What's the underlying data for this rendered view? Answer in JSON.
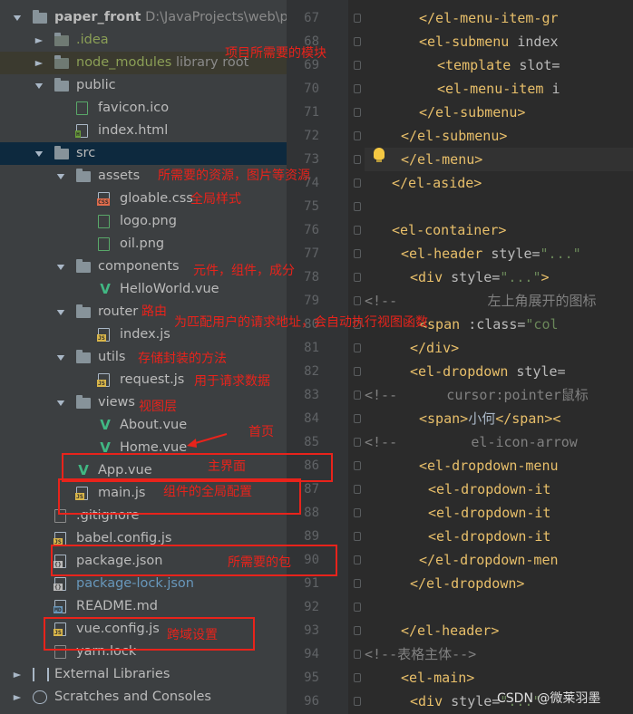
{
  "project": {
    "name": "paper_front",
    "path": "D:\\JavaProjects\\web\\pap"
  },
  "tree": [
    {
      "label": "paper_front",
      "suffix": "D:\\JavaProjects\\web\\pap",
      "indent": 0,
      "arrow": "down",
      "icon": "folder-icon",
      "color": "#bbbbbb",
      "bold": true
    },
    {
      "label": ".idea",
      "indent": 1,
      "arrow": "right",
      "icon": "folder-icon",
      "color": "#8b9f56"
    },
    {
      "label": "node_modules",
      "suffix": "library root",
      "indent": 1,
      "arrow": "right",
      "icon": "folder-icon",
      "color": "#8b9f56",
      "highlight": true
    },
    {
      "label": "public",
      "indent": 1,
      "arrow": "down",
      "icon": "folder-icon",
      "color": "#bbbbbb"
    },
    {
      "label": "favicon.ico",
      "indent": 2,
      "icon": "image-file-icon",
      "color": "#bbbbbb"
    },
    {
      "label": "index.html",
      "indent": 2,
      "icon": "html-file-icon",
      "color": "#bbbbbb"
    },
    {
      "label": "src",
      "indent": 1,
      "arrow": "down",
      "icon": "folder-icon",
      "color": "#bbbbbb",
      "selected": true
    },
    {
      "label": "assets",
      "indent": 2,
      "arrow": "down",
      "icon": "folder-icon",
      "color": "#bbbbbb"
    },
    {
      "label": "gloable.css",
      "indent": 3,
      "icon": "css-file-icon",
      "color": "#bbbbbb"
    },
    {
      "label": "logo.png",
      "indent": 3,
      "icon": "image-file-icon",
      "color": "#bbbbbb"
    },
    {
      "label": "oil.png",
      "indent": 3,
      "icon": "image-file-icon",
      "color": "#bbbbbb"
    },
    {
      "label": "components",
      "indent": 2,
      "arrow": "down",
      "icon": "folder-icon",
      "color": "#bbbbbb"
    },
    {
      "label": "HelloWorld.vue",
      "indent": 3,
      "icon": "vue-file-icon",
      "color": "#bbbbbb"
    },
    {
      "label": "router",
      "indent": 2,
      "arrow": "down",
      "icon": "folder-icon",
      "color": "#bbbbbb"
    },
    {
      "label": "index.js",
      "indent": 3,
      "icon": "js-file-icon",
      "color": "#bbbbbb"
    },
    {
      "label": "utils",
      "indent": 2,
      "arrow": "down",
      "icon": "folder-icon",
      "color": "#bbbbbb"
    },
    {
      "label": "request.js",
      "indent": 3,
      "icon": "js-file-icon",
      "color": "#bbbbbb"
    },
    {
      "label": "views",
      "indent": 2,
      "arrow": "down",
      "icon": "folder-icon",
      "color": "#bbbbbb"
    },
    {
      "label": "About.vue",
      "indent": 3,
      "icon": "vue-file-icon",
      "color": "#bbbbbb"
    },
    {
      "label": "Home.vue",
      "indent": 3,
      "icon": "vue-file-icon",
      "color": "#bbbbbb"
    },
    {
      "label": "App.vue",
      "indent": 2,
      "icon": "vue-file-icon",
      "color": "#bbbbbb"
    },
    {
      "label": "main.js",
      "indent": 2,
      "icon": "js-file-icon",
      "color": "#bbbbbb"
    },
    {
      "label": ".gitignore",
      "indent": 1,
      "icon": "ignore-file-icon",
      "color": "#bbbbbb"
    },
    {
      "label": "babel.config.js",
      "indent": 1,
      "icon": "js-file-icon",
      "color": "#bbbbbb"
    },
    {
      "label": "package.json",
      "indent": 1,
      "icon": "json-file-icon",
      "color": "#bbbbbb"
    },
    {
      "label": "package-lock.json",
      "indent": 1,
      "icon": "json-file-icon",
      "color": "#6897bb"
    },
    {
      "label": "README.md",
      "indent": 1,
      "icon": "md-file-icon",
      "color": "#bbbbbb"
    },
    {
      "label": "vue.config.js",
      "indent": 1,
      "icon": "js-file-icon",
      "color": "#bbbbbb"
    },
    {
      "label": "yarn.lock",
      "indent": 1,
      "icon": "text-file-icon",
      "color": "#bbbbbb"
    },
    {
      "label": "External Libraries",
      "indent": 0,
      "arrow": "right",
      "icon": "libraries-icon",
      "color": "#bbbbbb"
    },
    {
      "label": "Scratches and Consoles",
      "indent": 0,
      "arrow": "right",
      "icon": "scratches-icon",
      "color": "#bbbbbb"
    }
  ],
  "annotations": [
    "项目所需要的模块",
    "所需要的资源，图片等资源",
    "全局样式",
    "元件，组件，成分",
    "路由",
    "为匹配用户的请求地址，会自动执行视图函数",
    "存储封装的方法",
    "用于请求数据",
    "视图层",
    "首页",
    "主界面",
    "组件的全局配置",
    "所需要的包",
    "跨域设置"
  ],
  "editor": {
    "lines": [
      {
        "n": "67",
        "tokens": [
          {
            "c": "tx",
            "t": "    "
          },
          {
            "c": "tg",
            "t": "</el-menu-item-gr"
          }
        ]
      },
      {
        "n": "68",
        "tokens": [
          {
            "c": "tx",
            "t": "    "
          },
          {
            "c": "tg",
            "t": "<el-submenu "
          },
          {
            "c": "at",
            "t": "index"
          }
        ]
      },
      {
        "n": "69",
        "tokens": [
          {
            "c": "tx",
            "t": "      "
          },
          {
            "c": "tg",
            "t": "<template "
          },
          {
            "c": "at",
            "t": "slot="
          }
        ]
      },
      {
        "n": "70",
        "tokens": [
          {
            "c": "tx",
            "t": "      "
          },
          {
            "c": "tg",
            "t": "<el-menu-item "
          },
          {
            "c": "at",
            "t": "i"
          }
        ]
      },
      {
        "n": "71",
        "tokens": [
          {
            "c": "tx",
            "t": "    "
          },
          {
            "c": "tg",
            "t": "</el-submenu>"
          }
        ]
      },
      {
        "n": "72",
        "tokens": [
          {
            "c": "tx",
            "t": "  "
          },
          {
            "c": "tg",
            "t": "</el-submenu>"
          }
        ]
      },
      {
        "n": "73",
        "tokens": [
          {
            "c": "tx",
            "t": "  "
          },
          {
            "c": "tg",
            "t": "</el-menu>"
          }
        ],
        "current": true
      },
      {
        "n": "74",
        "tokens": [
          {
            "c": "tg",
            "t": "</el-aside>"
          }
        ]
      },
      {
        "n": "75",
        "tokens": []
      },
      {
        "n": "76",
        "tokens": [
          {
            "c": "tg",
            "t": "<el-container>"
          }
        ]
      },
      {
        "n": "77",
        "tokens": [
          {
            "c": "tx",
            "t": "  "
          },
          {
            "c": "tg",
            "t": "<el-header "
          },
          {
            "c": "at",
            "t": "style="
          },
          {
            "c": "sv",
            "t": "\"...\""
          }
        ]
      },
      {
        "n": "78",
        "tokens": [
          {
            "c": "tx",
            "t": "    "
          },
          {
            "c": "tg",
            "t": "<div "
          },
          {
            "c": "at",
            "t": "style="
          },
          {
            "c": "sv",
            "t": "\"...\""
          },
          {
            "c": "tg",
            "t": ">"
          }
        ]
      },
      {
        "n": "79",
        "tokens": [
          {
            "c": "cm",
            "t": "<!--           左上角展开的图标"
          }
        ]
      },
      {
        "n": "80",
        "tokens": [
          {
            "c": "tx",
            "t": "      "
          },
          {
            "c": "tg",
            "t": "<span "
          },
          {
            "c": "at",
            "t": ":class="
          },
          {
            "c": "sv",
            "t": "\"col"
          }
        ]
      },
      {
        "n": "81",
        "tokens": [
          {
            "c": "tx",
            "t": "    "
          },
          {
            "c": "tg",
            "t": "</div>"
          }
        ]
      },
      {
        "n": "82",
        "tokens": [
          {
            "c": "tx",
            "t": "    "
          },
          {
            "c": "tg",
            "t": "<el-dropdown "
          },
          {
            "c": "at",
            "t": "style="
          }
        ]
      },
      {
        "n": "83",
        "tokens": [
          {
            "c": "cm",
            "t": "<!--      cursor:pointer鼠标"
          }
        ]
      },
      {
        "n": "84",
        "tokens": [
          {
            "c": "tx",
            "t": "      "
          },
          {
            "c": "tg",
            "t": "<span>"
          },
          {
            "c": "tx",
            "t": "小何"
          },
          {
            "c": "tg",
            "t": "</span><"
          }
        ]
      },
      {
        "n": "85",
        "tokens": [
          {
            "c": "cm",
            "t": "<!--         el-icon-arrow"
          }
        ]
      },
      {
        "n": "86",
        "tokens": [
          {
            "c": "tx",
            "t": "      "
          },
          {
            "c": "tg",
            "t": "<el-dropdown-menu"
          }
        ]
      },
      {
        "n": "87",
        "tokens": [
          {
            "c": "tx",
            "t": "        "
          },
          {
            "c": "tg",
            "t": "<el-dropdown-it"
          }
        ]
      },
      {
        "n": "88",
        "tokens": [
          {
            "c": "tx",
            "t": "        "
          },
          {
            "c": "tg",
            "t": "<el-dropdown-it"
          }
        ]
      },
      {
        "n": "89",
        "tokens": [
          {
            "c": "tx",
            "t": "        "
          },
          {
            "c": "tg",
            "t": "<el-dropdown-it"
          }
        ]
      },
      {
        "n": "90",
        "tokens": [
          {
            "c": "tx",
            "t": "      "
          },
          {
            "c": "tg",
            "t": "</el-dropdown-men"
          }
        ]
      },
      {
        "n": "91",
        "tokens": [
          {
            "c": "tx",
            "t": "    "
          },
          {
            "c": "tg",
            "t": "</el-dropdown>"
          }
        ]
      },
      {
        "n": "92",
        "tokens": []
      },
      {
        "n": "93",
        "tokens": [
          {
            "c": "tx",
            "t": "  "
          },
          {
            "c": "tg",
            "t": "</el-header>"
          }
        ]
      },
      {
        "n": "94",
        "tokens": [
          {
            "c": "cm",
            "t": "<!--表格主体-->"
          }
        ]
      },
      {
        "n": "95",
        "tokens": [
          {
            "c": "tx",
            "t": "  "
          },
          {
            "c": "tg",
            "t": "<el-main>"
          }
        ]
      },
      {
        "n": "96",
        "tokens": [
          {
            "c": "tx",
            "t": "    "
          },
          {
            "c": "tg",
            "t": "<div "
          },
          {
            "c": "at",
            "t": "style="
          },
          {
            "c": "sv",
            "t": "\"...\""
          }
        ]
      }
    ]
  },
  "watermark": "CSDN @微莱羽墨"
}
